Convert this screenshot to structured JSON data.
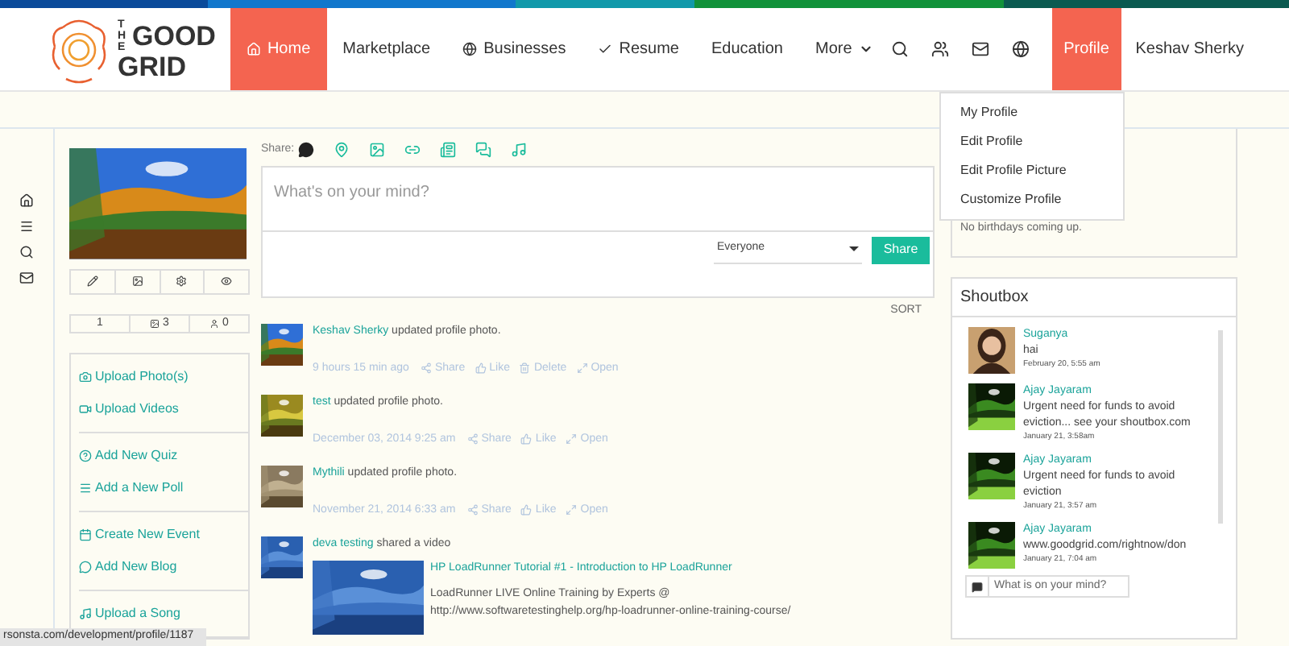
{
  "logo": {
    "line_1": "THE",
    "line_2": "GOOD",
    "line_3": "GRID"
  },
  "nav": [
    {
      "label": "Home",
      "selected": true
    },
    {
      "label": "Marketplace",
      "selected": false
    },
    {
      "label": "Businesses",
      "selected": false
    },
    {
      "label": "Resume",
      "selected": false
    },
    {
      "label": "Education",
      "selected": false
    },
    {
      "label": "More",
      "selected": false
    }
  ],
  "profile_menu": {
    "label": "Profile",
    "selected": true,
    "items": [
      "My Profile",
      "Edit Profile",
      "Edit Profile Picture",
      "Customize Profile"
    ]
  },
  "user_name": "Keshav Sherky",
  "profile_counts": [
    "1",
    "3",
    "0"
  ],
  "profile_links": [
    [
      "Upload Photo(s)",
      "Upload Videos"
    ],
    [
      "Add New Quiz",
      "Add a New Poll"
    ],
    [
      "Create New Event",
      "Add New Blog"
    ],
    [
      "Upload a Song"
    ]
  ],
  "composer": {
    "share_label": "Share:",
    "placeholder": "What's on your mind?",
    "audience": "Everyone",
    "button": "Share",
    "sort": "SORT"
  },
  "posts": [
    {
      "author": "Keshav Sherky",
      "text": "updated profile photo.",
      "time": "9 hours 15 min ago",
      "actions": [
        "Share",
        "Like",
        "Delete",
        "Open"
      ]
    },
    {
      "author": "test",
      "text": "updated profile photo.",
      "time": "December 03, 2014 9:25 am",
      "actions": [
        "Share",
        "Like",
        "Open"
      ]
    },
    {
      "author": "Mythili",
      "text": "updated profile photo.",
      "time": "November 21, 2014 6:33 am",
      "actions": [
        "Share",
        "Like",
        "Open"
      ]
    },
    {
      "author": "deva testing",
      "text": "shared a video",
      "video": {
        "title": "HP LoadRunner Tutorial #1 - Introduction to HP LoadRunner",
        "line_1": "LoadRunner LIVE Online Training by Experts @",
        "line_2": "http://www.softwaretestinghelp.org/hp-loadrunner-online-training-course/"
      }
    }
  ],
  "birthdays": "No birthdays coming up.",
  "shoutbox": {
    "title": "Shoutbox",
    "placeholder": "What is on your mind?",
    "messages": [
      {
        "name": "Suganya",
        "text": "hai",
        "time": "February 20, 5:55 am"
      },
      {
        "name": "Ajay Jayaram",
        "text": "Urgent need for funds to avoid eviction... see your shoutbox.com",
        "time": "January 21, 3:58am"
      },
      {
        "name": "Ajay Jayaram",
        "text": "Urgent need for funds to avoid eviction",
        "time": "January 21, 3:57 am"
      },
      {
        "name": "Ajay Jayaram",
        "text": "www.goodgrid.com/rightnow/don",
        "time": "January 21, 7:04 am"
      }
    ]
  },
  "status_bar": "rsonsta.com/development/profile/1187"
}
